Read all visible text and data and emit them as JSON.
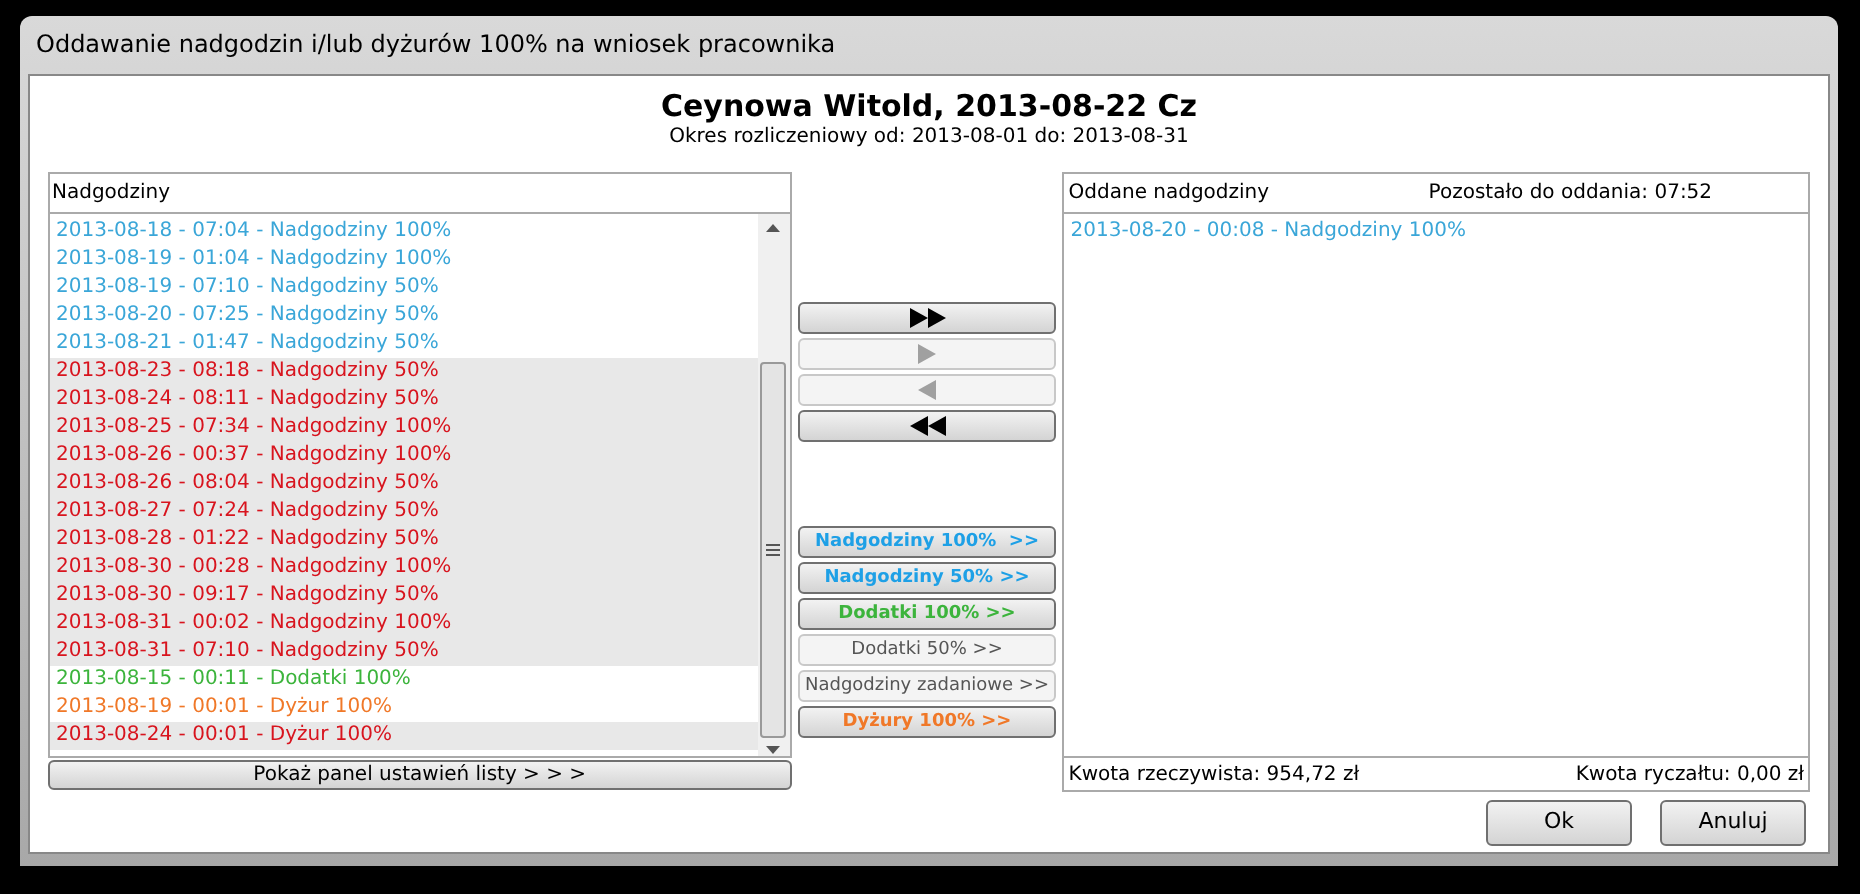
{
  "window": {
    "title": "Oddawanie nadgodzin i/lub dyżurów 100% na wniosek pracownika"
  },
  "header": {
    "name": "Ceynowa Witold, 2013-08-22 Cz",
    "period": "Okres rozliczeniowy od: 2013-08-01 do: 2013-08-31"
  },
  "left_list": {
    "title": "Nadgodziny",
    "rows": [
      {
        "text": "2013-08-18 - 07:04 - Nadgodziny 100%",
        "color": "#3aa6d8",
        "selected": false
      },
      {
        "text": "2013-08-19 - 01:04 - Nadgodziny 100%",
        "color": "#3aa6d8",
        "selected": false
      },
      {
        "text": "2013-08-19 - 07:10 - Nadgodziny 50%",
        "color": "#3aa6d8",
        "selected": false
      },
      {
        "text": "2013-08-20 - 07:25 - Nadgodziny 50%",
        "color": "#3aa6d8",
        "selected": false
      },
      {
        "text": "2013-08-21 - 01:47 - Nadgodziny 50%",
        "color": "#3aa6d8",
        "selected": false
      },
      {
        "text": "2013-08-23 - 08:18 - Nadgodziny 50%",
        "color": "#d8141e",
        "selected": true
      },
      {
        "text": "2013-08-24 - 08:11 - Nadgodziny 50%",
        "color": "#d8141e",
        "selected": true
      },
      {
        "text": "2013-08-25 - 07:34 - Nadgodziny 100%",
        "color": "#d8141e",
        "selected": true
      },
      {
        "text": "2013-08-26 - 00:37 - Nadgodziny 100%",
        "color": "#d8141e",
        "selected": true
      },
      {
        "text": "2013-08-26 - 08:04 - Nadgodziny 50%",
        "color": "#d8141e",
        "selected": true
      },
      {
        "text": "2013-08-27 - 07:24 - Nadgodziny 50%",
        "color": "#d8141e",
        "selected": true
      },
      {
        "text": "2013-08-28 - 01:22 - Nadgodziny 50%",
        "color": "#d8141e",
        "selected": true
      },
      {
        "text": "2013-08-30 - 00:28 - Nadgodziny 100%",
        "color": "#d8141e",
        "selected": true
      },
      {
        "text": "2013-08-30 - 09:17 - Nadgodziny 50%",
        "color": "#d8141e",
        "selected": true
      },
      {
        "text": "2013-08-31 - 00:02 - Nadgodziny 100%",
        "color": "#d8141e",
        "selected": true
      },
      {
        "text": "2013-08-31 - 07:10 - Nadgodziny 50%",
        "color": "#d8141e",
        "selected": true
      },
      {
        "text": "2013-08-15 - 00:11 - Dodatki 100%",
        "color": "#3cb43c",
        "selected": false
      },
      {
        "text": "2013-08-19 - 00:01 - Dyżur 100%",
        "color": "#f07828",
        "selected": false
      },
      {
        "text": "2013-08-24 - 00:01 - Dyżur 100%",
        "color": "#d8141e",
        "selected": true
      }
    ],
    "footer_button": "Pokaż panel ustawień listy > > >"
  },
  "move_buttons": [
    {
      "kind": "all-right",
      "disabled": false
    },
    {
      "kind": "right",
      "disabled": true
    },
    {
      "kind": "left",
      "disabled": true
    },
    {
      "kind": "all-left",
      "disabled": false
    }
  ],
  "category_buttons": [
    {
      "label": "Nadgodziny 100%  >>",
      "color": "#1ea0e6",
      "disabled": false
    },
    {
      "label": "Nadgodziny 50% >>",
      "color": "#1ea0e6",
      "disabled": false
    },
    {
      "label": "Dodatki 100% >>",
      "color": "#3cb43c",
      "disabled": false
    },
    {
      "label": "Dodatki 50% >>",
      "color": "#555555",
      "disabled": true
    },
    {
      "label": "Nadgodziny zadaniowe >>",
      "color": "#555555",
      "disabled": true
    },
    {
      "label": "Dyżury 100% >>",
      "color": "#f07828",
      "disabled": false
    }
  ],
  "right_list": {
    "title": "Oddane nadgodziny",
    "remaining": "Pozostało do oddania: 07:52",
    "rows": [
      {
        "text": "2013-08-20 - 00:08 - Nadgodziny 100%",
        "color": "#3aa6d8",
        "selected": false
      }
    ],
    "actual_amount": "Kwota rzeczywista: 954,72 zł",
    "flat_amount": "Kwota ryczałtu: 0,00 zł"
  },
  "buttons": [
    "Ok",
    "Anuluj"
  ]
}
